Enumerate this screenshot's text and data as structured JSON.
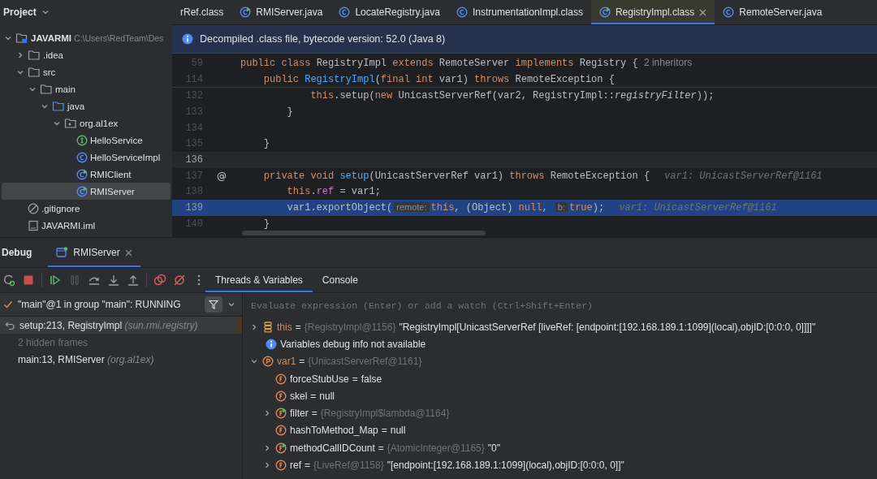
{
  "project": {
    "title": "Project",
    "tree": [
      {
        "name": "JAVARMI",
        "path": "C:\\Users\\RedTeam\\Des",
        "kind": "module",
        "expanded": true,
        "selected": false,
        "children": [
          {
            "name": ".idea",
            "kind": "folder",
            "expanded": false,
            "selected": false
          },
          {
            "name": "src",
            "kind": "folder",
            "expanded": true,
            "selected": false,
            "children": [
              {
                "name": "main",
                "kind": "folder",
                "expanded": true,
                "selected": false,
                "children": [
                  {
                    "name": "java",
                    "kind": "source-folder",
                    "expanded": true,
                    "selected": false,
                    "children": [
                      {
                        "name": "org.al1ex",
                        "kind": "package",
                        "expanded": true,
                        "selected": false,
                        "children": [
                          {
                            "name": "HelloService",
                            "kind": "interface",
                            "selected": false
                          },
                          {
                            "name": "HelloServiceImpl",
                            "kind": "class",
                            "selected": false
                          },
                          {
                            "name": "RMIClient",
                            "kind": "runnable-class",
                            "selected": false
                          },
                          {
                            "name": "RMIServer",
                            "kind": "runnable-class",
                            "selected": true
                          }
                        ]
                      }
                    ]
                  }
                ]
              }
            ]
          },
          {
            "name": ".gitignore",
            "kind": "ignore",
            "selected": false
          },
          {
            "name": "JAVARMI.iml",
            "kind": "iml",
            "selected": false
          }
        ]
      }
    ]
  },
  "editor": {
    "tabs": [
      {
        "label": "rRef.class",
        "kind": "none",
        "selected": false
      },
      {
        "label": "RMIServer.java",
        "kind": "runnable-class",
        "selected": false
      },
      {
        "label": "LocateRegistry.java",
        "kind": "class",
        "selected": false
      },
      {
        "label": "InstrumentationImpl.class",
        "kind": "class",
        "selected": false
      },
      {
        "label": "RegistryImpl.class",
        "kind": "runnable-class",
        "selected": true
      },
      {
        "label": "RemoteServer.java",
        "kind": "class",
        "selected": false
      }
    ],
    "banner": "Decompiled .class file, bytecode version: 52.0 (Java 8)",
    "sticky_lines": [
      {
        "number": "59",
        "tokens": [
          {
            "kind": "keyword",
            "text": "public class "
          },
          {
            "kind": "plain",
            "text": "RegistryImpl "
          },
          {
            "kind": "keyword",
            "text": "extends "
          },
          {
            "kind": "plain",
            "text": "RemoteServer "
          },
          {
            "kind": "keyword",
            "text": "implements "
          },
          {
            "kind": "plain",
            "text": "Registry { "
          },
          {
            "kind": "hint",
            "text": "2 inheritors"
          }
        ]
      },
      {
        "number": "114",
        "tokens": [
          {
            "kind": "keyword",
            "text": "    public "
          },
          {
            "kind": "method",
            "text": "RegistryImpl"
          },
          {
            "kind": "plain",
            "text": "("
          },
          {
            "kind": "keyword",
            "text": "final int "
          },
          {
            "kind": "plain",
            "text": "var1) "
          },
          {
            "kind": "keyword",
            "text": "throws "
          },
          {
            "kind": "plain",
            "text": "RemoteException {"
          }
        ]
      }
    ],
    "lines": [
      {
        "number": "132",
        "current": false,
        "highlighted": false,
        "tokens": [
          {
            "kind": "keyword",
            "text": "            this"
          },
          {
            "kind": "plain",
            "text": ".setup("
          },
          {
            "kind": "keyword",
            "text": "new "
          },
          {
            "kind": "plain",
            "text": "UnicastServerRef(var2, RegistryImpl::"
          },
          {
            "kind": "italic",
            "text": "registryFilter"
          },
          {
            "kind": "plain",
            "text": "));"
          }
        ]
      },
      {
        "number": "133",
        "current": false,
        "highlighted": false,
        "tokens": [
          {
            "kind": "plain",
            "text": "        }"
          }
        ]
      },
      {
        "number": "134",
        "current": false,
        "highlighted": false
      },
      {
        "number": "135",
        "current": false,
        "highlighted": false,
        "tokens": [
          {
            "kind": "plain",
            "text": "    }"
          }
        ]
      },
      {
        "number": "136",
        "current": true,
        "highlighted": false
      },
      {
        "number": "137",
        "current": false,
        "highlighted": false,
        "gutter": "@",
        "tokens": [
          {
            "kind": "keyword",
            "text": "    private void "
          },
          {
            "kind": "method",
            "text": "setup"
          },
          {
            "kind": "plain",
            "text": "(UnicastServerRef var1) "
          },
          {
            "kind": "keyword",
            "text": "throws "
          },
          {
            "kind": "plain",
            "text": "RemoteException {"
          },
          {
            "kind": "value",
            "text": "var1: UnicastServerRef@1161"
          }
        ]
      },
      {
        "number": "138",
        "current": false,
        "highlighted": false,
        "tokens": [
          {
            "kind": "keyword",
            "text": "        this"
          },
          {
            "kind": "plain",
            "text": "."
          },
          {
            "kind": "field",
            "text": "ref"
          },
          {
            "kind": "plain",
            "text": " = var1;"
          }
        ]
      },
      {
        "number": "139",
        "current": false,
        "highlighted": true,
        "tokens": [
          {
            "kind": "plain",
            "text": "        var1.exportObject("
          },
          {
            "kind": "inlay",
            "text": "remote:"
          },
          {
            "kind": "keyword",
            "text": "this"
          },
          {
            "kind": "plain",
            "text": ", (Object) "
          },
          {
            "kind": "keyword",
            "text": "null"
          },
          {
            "kind": "plain",
            "text": ", "
          },
          {
            "kind": "inlay",
            "text": "b:"
          },
          {
            "kind": "keyword",
            "text": "true"
          },
          {
            "kind": "plain",
            "text": ");"
          },
          {
            "kind": "value",
            "text": "var1: UnicastServerRef@1161"
          }
        ]
      },
      {
        "number": "140",
        "current": false,
        "highlighted": false,
        "tokens": [
          {
            "kind": "plain",
            "text": "    }"
          }
        ]
      }
    ]
  },
  "debug": {
    "title": "Debug",
    "sessions": [
      {
        "label": "RMIServer",
        "selected": true
      }
    ],
    "tabs": [
      {
        "label": "Threads & Variables",
        "selected": true
      },
      {
        "label": "Console",
        "selected": false
      }
    ],
    "thread": "\"main\"@1 in group \"main\": RUNNING",
    "frames": [
      {
        "kind": "frame",
        "method": "setup:213, RegistryImpl",
        "package": "(sun.rmi.registry)",
        "selected": true
      },
      {
        "kind": "hidden",
        "method": "2 hidden frames",
        "selected": false
      },
      {
        "kind": "frame",
        "method": "main:13, RMIServer",
        "package": "(org.al1ex)",
        "selected": false
      }
    ],
    "evaluate": {
      "placeholder": "Evaluate expression (Enter) or add a watch (Ctrl+Shift+Enter)"
    },
    "variables": [
      {
        "kind": "local",
        "name": "this",
        "operator": "=",
        "type": "{RegistryImpl@1156}",
        "value": "\"RegistryImpl[UnicastServerRef [liveRef: [endpoint:[192.168.189.1:1099](local),objID:[0:0:0, 0]]]]\"",
        "expanded": false
      },
      {
        "kind": "info",
        "text": "Variables debug info not available"
      },
      {
        "kind": "parameter",
        "name": "var1",
        "operator": "=",
        "type": "{UnicastServerRef@1161}",
        "expanded": true,
        "children": [
          {
            "kind": "field",
            "name": "forceStubUse",
            "operator": "=",
            "value": "false"
          },
          {
            "kind": "field",
            "name": "skel",
            "operator": "=",
            "value": "null"
          },
          {
            "kind": "final-field",
            "name": "filter",
            "operator": "=",
            "type": "{RegistryImpl$lambda@1164}",
            "expanded": false
          },
          {
            "kind": "field",
            "name": "hashToMethod_Map",
            "operator": "=",
            "value": "null"
          },
          {
            "kind": "final-field",
            "name": "methodCallIDCount",
            "operator": "=",
            "type": "{AtomicInteger@1165}",
            "value": "\"0\"",
            "expanded": false
          },
          {
            "kind": "field",
            "name": "ref",
            "operator": "=",
            "type": "{LiveRef@1158}",
            "value": "\"[endpoint:[192.168.189.1:1099](local),objID:[0:0:0, 0]]\"",
            "expanded": false
          }
        ]
      }
    ]
  }
}
